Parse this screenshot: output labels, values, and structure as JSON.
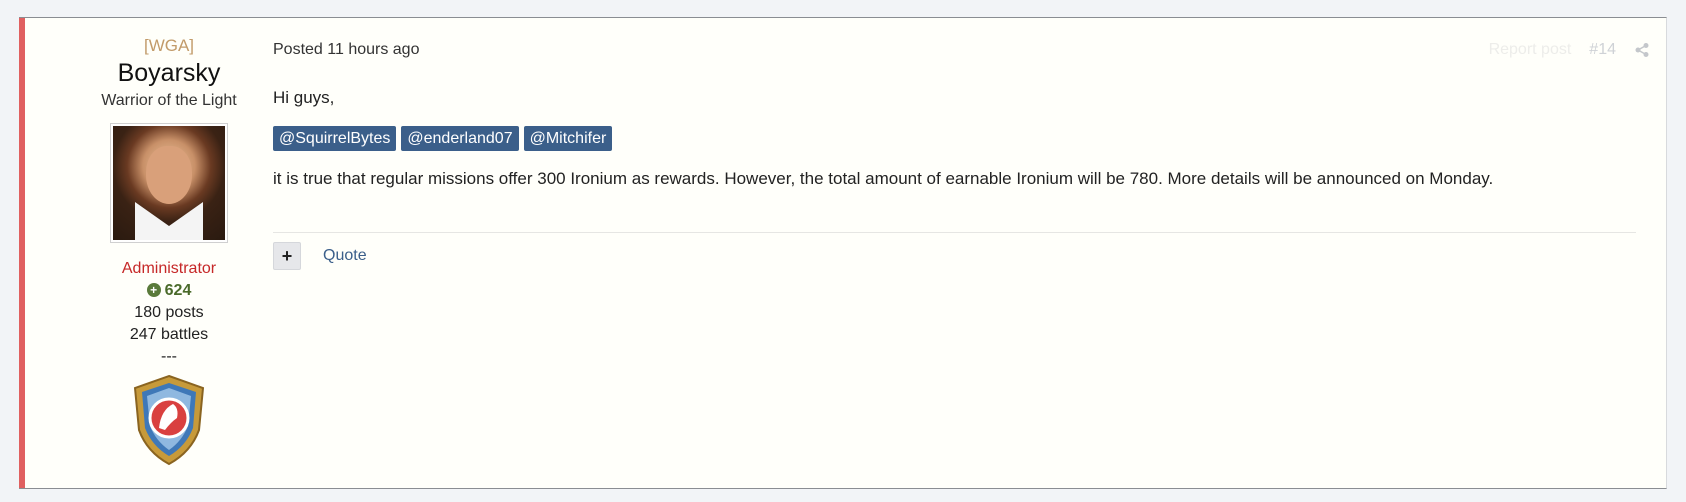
{
  "author": {
    "clan": "[WGA]",
    "username": "Boyarsky",
    "title": "Warrior of the Light",
    "group": "Administrator",
    "reputation": "624",
    "posts": "180 posts",
    "battles": "247 battles",
    "separator": "---",
    "avatar_icon": "user-avatar",
    "badge_icon": "wg-shield-badge"
  },
  "post": {
    "meta": "Posted 11 hours ago",
    "report_label": "Report post",
    "number": "#14",
    "share_icon": "share-icon",
    "greeting": "Hi guys,",
    "mentions": [
      "@SquirrelBytes",
      "@enderland07",
      "@Mitchifer"
    ],
    "message": "it is true that regular missions offer 300 Ironium as rewards. However, the total amount of earnable Ironium will be 780. More details will be announced on Monday.",
    "quote_label": "Quote",
    "plus_label": "+"
  },
  "colors": {
    "accent_stripe": "#e06060",
    "mention_bg": "#3b5f8a",
    "group": "#c62828",
    "clan": "#c29b6a"
  }
}
